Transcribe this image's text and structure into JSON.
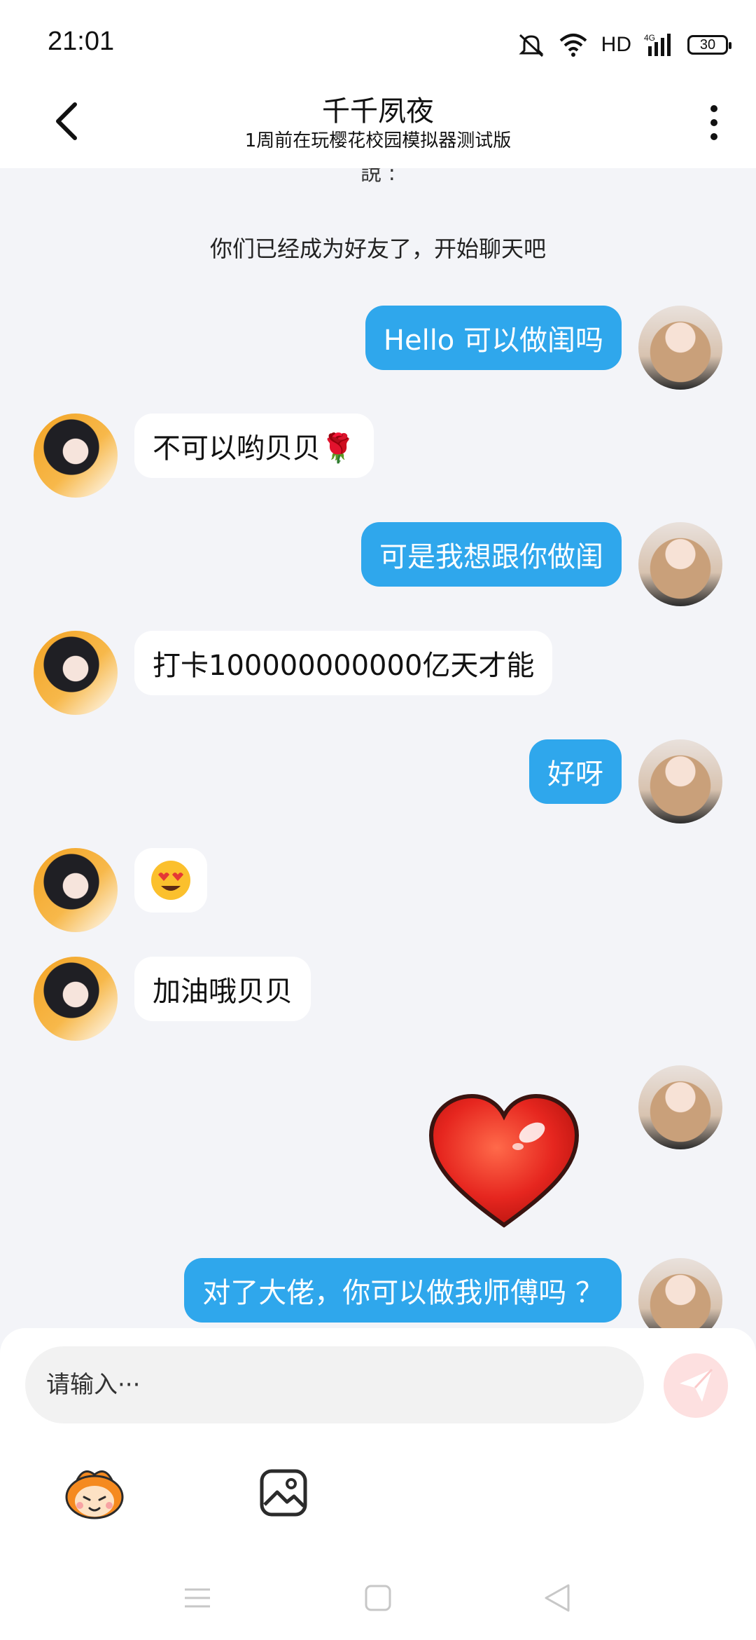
{
  "status_bar": {
    "time": "21:01",
    "network": "HD",
    "cell": "4G",
    "battery": "30"
  },
  "header": {
    "title": "千千夙夜",
    "subtitle": "1周前在玩樱花校园模拟器测试版"
  },
  "chat": {
    "cut_text": "說 :",
    "system_message": "你们已经成为好友了，开始聊天吧",
    "messages": [
      {
        "from": "me",
        "text": "Hello 可以做闺吗"
      },
      {
        "from": "other",
        "text": "不可以哟贝贝🌹"
      },
      {
        "from": "me",
        "text": "可是我想跟你做闺"
      },
      {
        "from": "other",
        "text": "打卡100000000000亿天才能"
      },
      {
        "from": "me",
        "text": "好呀"
      },
      {
        "from": "other",
        "text": "😍"
      },
      {
        "from": "other",
        "text": "加油哦贝贝"
      },
      {
        "from": "me",
        "sticker": "heart-sticker"
      },
      {
        "from": "me",
        "text": "对了大佬，你可以做我师傅吗 ？"
      }
    ]
  },
  "input": {
    "placeholder": "请输入···"
  },
  "colors": {
    "my_bubble": "#2fa7ec",
    "other_bubble": "#ffffff",
    "background": "#f3f4f8",
    "send_button": "#fde0e0"
  }
}
